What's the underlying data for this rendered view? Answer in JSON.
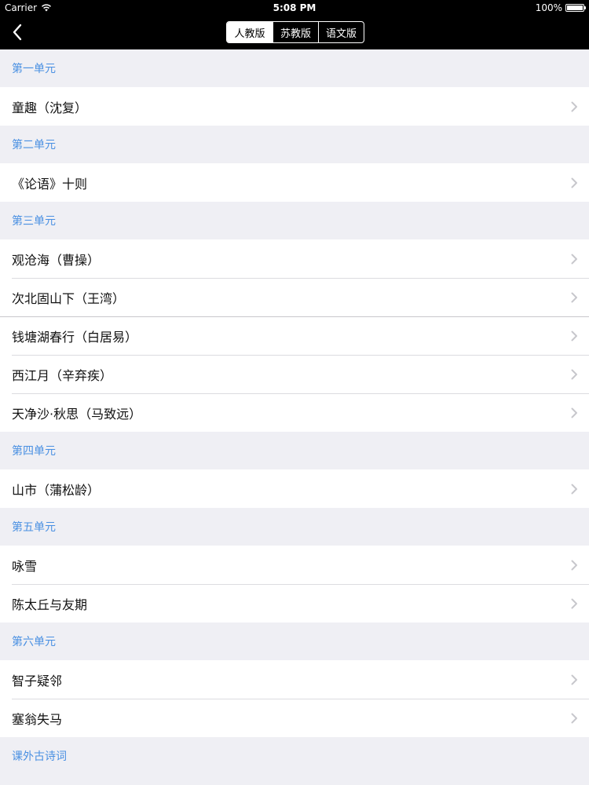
{
  "status_bar": {
    "carrier": "Carrier",
    "time": "5:08 PM",
    "battery": "100%",
    "battery_level": 1.0
  },
  "nav": {
    "back_icon": "chevron-left-icon",
    "segments": [
      {
        "label": "人教版",
        "selected": true
      },
      {
        "label": "苏教版",
        "selected": false
      },
      {
        "label": "语文版",
        "selected": false
      }
    ]
  },
  "sections": [
    {
      "title": "第一单元",
      "items": [
        "童趣（沈复）"
      ]
    },
    {
      "title": "第二单元",
      "items": [
        "《论语》十则"
      ]
    },
    {
      "title": "第三单元",
      "items": [
        "观沧海（曹操）",
        "次北固山下（王湾）",
        "钱塘湖春行（白居易）",
        "西江月（辛弃疾）",
        "天净沙·秋思（马致远）"
      ]
    },
    {
      "title": "第四单元",
      "items": [
        "山市（蒲松龄）"
      ]
    },
    {
      "title": "第五单元",
      "items": [
        "咏雪",
        "陈太丘与友期"
      ]
    },
    {
      "title": "第六单元",
      "items": [
        "智子疑邻",
        "塞翁失马"
      ]
    },
    {
      "title": "课外古诗词",
      "items": []
    }
  ],
  "colors": {
    "accent": "#4a90e2",
    "nav_bg": "#000000",
    "section_bg": "#efeff4"
  }
}
